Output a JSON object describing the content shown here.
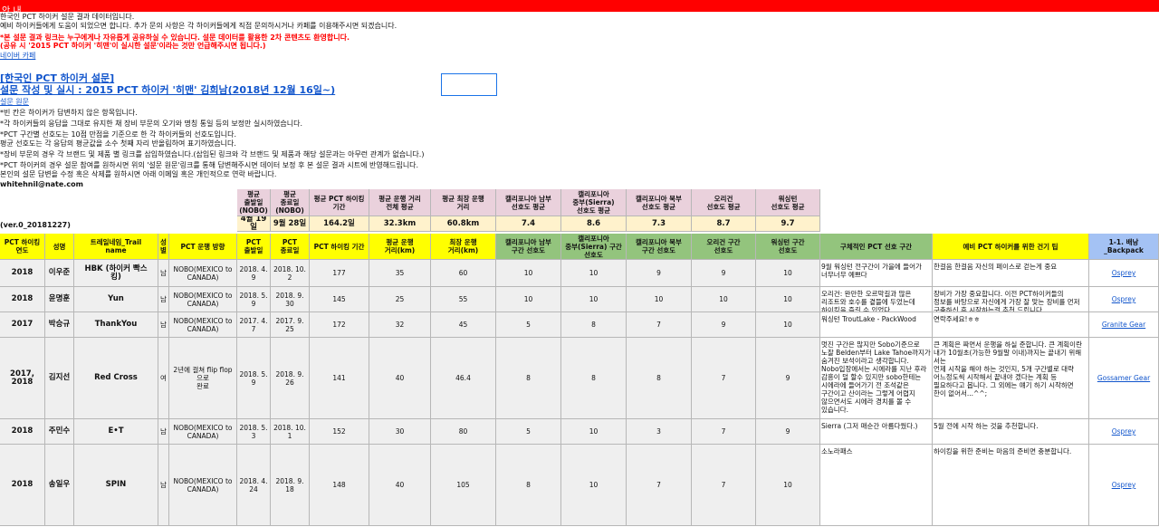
{
  "banner": {
    "title": "안 내"
  },
  "notice": {
    "line1": "한국인 PCT 하이커 설문 결과 데이터입니다.",
    "line2": "예비 하이커들에게 도움이 되었으면 합니다. 추가 문의 사항은 각 하이커들에게 직접 문의하시거나 카페를 이용해주시면 되겠습니다.",
    "red1": "*본 설문 결과 링크는 누구에게나 자유롭게 공유하실 수 있습니다. 설문 데이터를 활용한 2차 콘텐츠도 환영합니다.",
    "red2": "(공유 시 '2015 PCT 하이커 '히맨'이 실시한 설문'이라는 것만 언급해주시면 됩니다.)",
    "cafe_link": "네이버 카페"
  },
  "survey": {
    "title1": "[한국인 PCT 하이커 설문]",
    "title2": "설문 작성 및 실시 : 2015 PCT 하이커 '히맨' 김희남(2018년 12월 16일~)",
    "link": "설문 원문",
    "notes": [
      "*빈 칸은 하이커가 답변하지 않은 항목입니다.",
      "*각 하이커들의 응답을 그대로 유지한 채 장비 부문의 오기와 명칭 통일 등의 보정만 실시하였습니다.",
      "*PCT 구간별 선호도는 10점 만점을 기준으로 한 각 하이커들의 선호도입니다.",
      "평균 선호도는 각 응답의 평균값을 소수 첫째 자리 반올림하여 표기하였습니다.",
      "*장비 부문의 경우 각 브랜드 및 제품 별 링크를 삽입하였습니다.(삽입된 링크와 각 브랜드 및 제품과 해당 설문과는 아무런 관계가 없습니다.)",
      "*PCT 하이커의 경우 설문 참여를 원하시면 위의 '설문 원문'링크를 통해 답변해주시면 데이터 보정 후 본 설문 결과 시트에 반영해드립니다.",
      "본인의 설문 답변을 수정 혹은 삭제를 원하시면 아래 이메일 혹은 개인적으로 연락 바랍니다."
    ],
    "email": "whitehnil@nate.com",
    "version": "(ver.0_20181227)"
  },
  "averages": {
    "headers": [
      "평균\n출발일\n(NOBO)",
      "평균\n종료일\n(NOBO)",
      "평균 PCT 하이킹\n기간",
      "평균 운행 거리\n전체 평균",
      "평균 최장 운행\n거리",
      "캘리포니아 남부\n선호도 평균",
      "캘리포니아\n중부(Sierra)\n선호도 평균",
      "캘리포니아 북부\n선호도 평균",
      "오리건\n선호도 평균",
      "워싱턴\n선호도 평균"
    ],
    "values": [
      "4월 19일",
      "9월 28일",
      "164.2일",
      "32.3km",
      "60.8km",
      "7.4",
      "8.6",
      "7.3",
      "8.7",
      "9.7"
    ]
  },
  "table": {
    "headers": [
      "PCT 하이킹\n연도",
      "성명",
      "트레일네임_Trail\nname",
      "성\n별",
      "PCT 운행 방향",
      "PCT\n출발일",
      "PCT\n종료일",
      "PCT 하이킹 기간",
      "평균 운행\n거리(km)",
      "최장 운행\n거리(km)",
      "캘리포니아 남부\n구간 선호도",
      "캘리포니아\n중부(Sierra) 구간\n선호도",
      "캘리포니아 북부\n구간 선호도",
      "오리건 구간\n선호도",
      "워싱턴 구간\n선호도",
      "구체적인 PCT 선호 구간",
      "예비 PCT 하이커를 위한 건기 팁",
      "1-1. 배낭_Backpack"
    ],
    "rows": [
      [
        "2018",
        "이우준",
        "HBK (하이커 빡스\n킹)",
        "남",
        "NOBO(MEXICO to\nCANADA)",
        "2018. 4. 9",
        "2018. 10. 2",
        "177",
        "35",
        "60",
        "10",
        "10",
        "9",
        "9",
        "10",
        "9월 워싱턴 전구간이 가을에 들어가\n너무너무 예쁘다",
        "한걸음 한걸음 자신의 페이스로 걷는게 중요",
        "Osprey"
      ],
      [
        "2018",
        "윤명훈",
        "Yun",
        "남",
        "NOBO(MEXICO to\nCANADA)",
        "2018. 5. 9",
        "2018. 9. 30",
        "145",
        "25",
        "55",
        "10",
        "10",
        "10",
        "10",
        "10",
        "오리건: 완만한 오르막길과 많은\n리조트와 호수를 곁뜰에 두었는데\n하이킹을 즐길 수 있었다.",
        "장비가 가장 중요합니다. 이전 PCT하이커들의\n정보를 바탕으로 자신에게 가장 잘 맞는 장비를 먼저\n구축하신 후 시작하는걸 추천 드립니다.",
        "Osprey"
      ],
      [
        "2017",
        "박승규",
        "ThankYou",
        "남",
        "NOBO(MEXICO to\nCANADA)",
        "2017. 4. 7",
        "2017. 9. 25",
        "172",
        "32",
        "45",
        "5",
        "8",
        "7",
        "9",
        "10",
        "워싱턴 TroutLake - PackWood",
        "연락주세요!ㅎㅎ",
        "Granite Gear"
      ],
      [
        "2017, 2018",
        "김지선",
        "Red Cross",
        "여",
        "2년에 걸쳐 flip flop으로\n완료",
        "2018. 5. 9",
        "2018. 9. 26",
        "141",
        "40",
        "46.4",
        "8",
        "8",
        "8",
        "7",
        "9",
        "멋진 구간은 많지만 Sobo기준으로\n노잘 Belden부터 Lake Tahoe까지가\n숨겨진 보석이라고 생각합니다.\nNobo입장에서는 시에라를 지난 후라\n감흥이 덜 할수 있지만 sobo한테는\n시에라에 들어가기 전 조석같은\n구간이고 산이라는 그렇게 어렵지\n않으면서도 시에라 경치를 볼 수\n있습니다.",
        "큰 계획은 짜면서 운행을 하실 준합니다. 큰 계획이란\n내가 10월초(가능한 9월말 이내)까지는 끝내기 위해서는\n언제 시작을 해야 하는 것인지, 5개 구간별로 대략\n어느정도씩 시작해서 끝내야 겠다는 계획 등\n필요하다고 봅니다. 그 외에는 얘기 하기 시작하면\n한이 없어서...^^;",
        "Gossamer Gear"
      ],
      [
        "2018",
        "주민수",
        "E•T",
        "남",
        "NOBO(MEXICO to\nCANADA)",
        "2018. 5. 3",
        "2018. 10. 1",
        "152",
        "30",
        "80",
        "5",
        "10",
        "3",
        "7",
        "9",
        "Sierra (그저 매순간 아름다웠다.)",
        "5월 전에 시작 하는 것을 추천합니다.",
        "Osprey"
      ],
      [
        "2018",
        "송일우",
        "SPIN",
        "남",
        "NOBO(MEXICO to\nCANADA)",
        "2018. 4. 24",
        "2018. 9. 18",
        "148",
        "40",
        "105",
        "8",
        "10",
        "7",
        "7",
        "10",
        "소노라패스",
        "하이킹을 위한 준비는 마음의 준비면 충분합니다.",
        "Osprey"
      ]
    ]
  }
}
